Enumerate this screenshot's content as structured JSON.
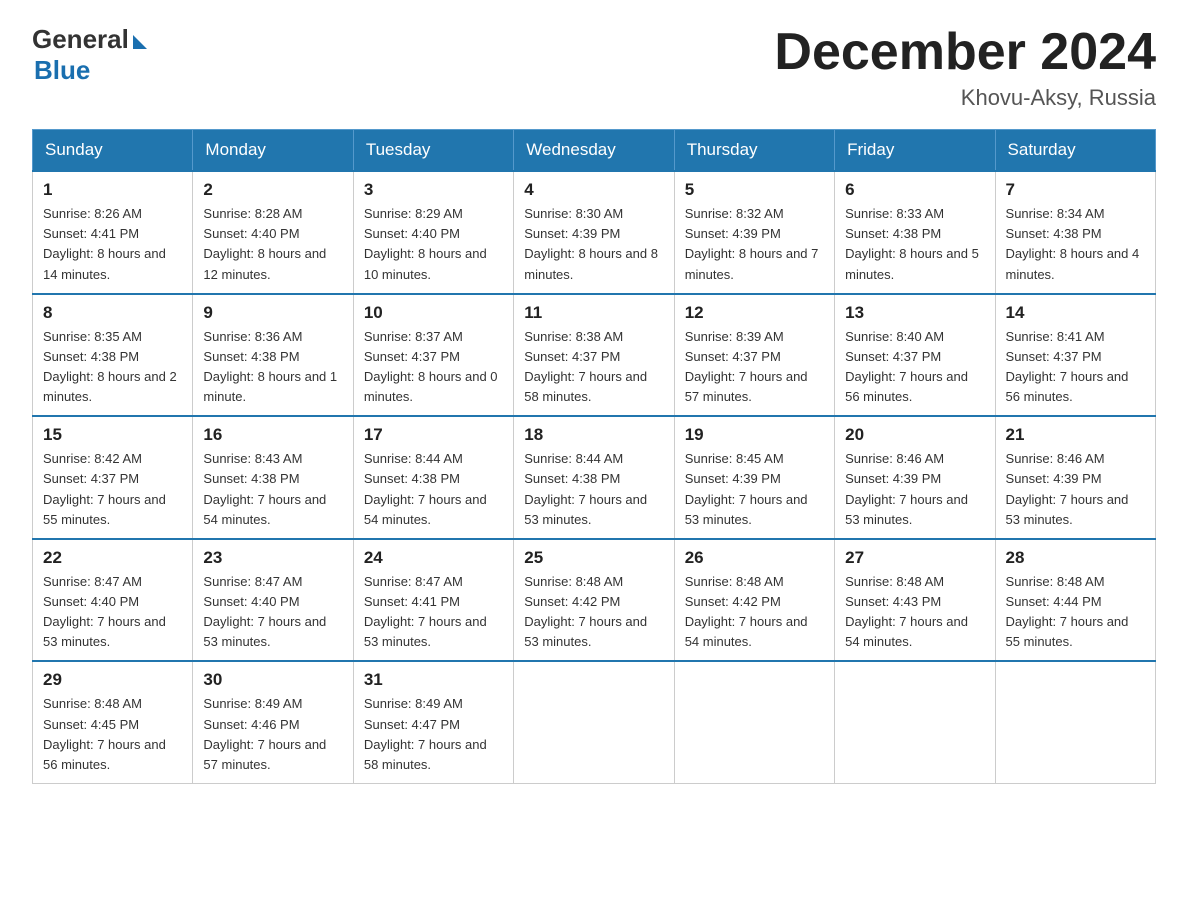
{
  "logo": {
    "general": "General",
    "blue": "Blue"
  },
  "title": "December 2024",
  "subtitle": "Khovu-Aksy, Russia",
  "days_of_week": [
    "Sunday",
    "Monday",
    "Tuesday",
    "Wednesday",
    "Thursday",
    "Friday",
    "Saturday"
  ],
  "weeks": [
    [
      {
        "day": "1",
        "sunrise": "8:26 AM",
        "sunset": "4:41 PM",
        "daylight": "8 hours and 14 minutes."
      },
      {
        "day": "2",
        "sunrise": "8:28 AM",
        "sunset": "4:40 PM",
        "daylight": "8 hours and 12 minutes."
      },
      {
        "day": "3",
        "sunrise": "8:29 AM",
        "sunset": "4:40 PM",
        "daylight": "8 hours and 10 minutes."
      },
      {
        "day": "4",
        "sunrise": "8:30 AM",
        "sunset": "4:39 PM",
        "daylight": "8 hours and 8 minutes."
      },
      {
        "day": "5",
        "sunrise": "8:32 AM",
        "sunset": "4:39 PM",
        "daylight": "8 hours and 7 minutes."
      },
      {
        "day": "6",
        "sunrise": "8:33 AM",
        "sunset": "4:38 PM",
        "daylight": "8 hours and 5 minutes."
      },
      {
        "day": "7",
        "sunrise": "8:34 AM",
        "sunset": "4:38 PM",
        "daylight": "8 hours and 4 minutes."
      }
    ],
    [
      {
        "day": "8",
        "sunrise": "8:35 AM",
        "sunset": "4:38 PM",
        "daylight": "8 hours and 2 minutes."
      },
      {
        "day": "9",
        "sunrise": "8:36 AM",
        "sunset": "4:38 PM",
        "daylight": "8 hours and 1 minute."
      },
      {
        "day": "10",
        "sunrise": "8:37 AM",
        "sunset": "4:37 PM",
        "daylight": "8 hours and 0 minutes."
      },
      {
        "day": "11",
        "sunrise": "8:38 AM",
        "sunset": "4:37 PM",
        "daylight": "7 hours and 58 minutes."
      },
      {
        "day": "12",
        "sunrise": "8:39 AM",
        "sunset": "4:37 PM",
        "daylight": "7 hours and 57 minutes."
      },
      {
        "day": "13",
        "sunrise": "8:40 AM",
        "sunset": "4:37 PM",
        "daylight": "7 hours and 56 minutes."
      },
      {
        "day": "14",
        "sunrise": "8:41 AM",
        "sunset": "4:37 PM",
        "daylight": "7 hours and 56 minutes."
      }
    ],
    [
      {
        "day": "15",
        "sunrise": "8:42 AM",
        "sunset": "4:37 PM",
        "daylight": "7 hours and 55 minutes."
      },
      {
        "day": "16",
        "sunrise": "8:43 AM",
        "sunset": "4:38 PM",
        "daylight": "7 hours and 54 minutes."
      },
      {
        "day": "17",
        "sunrise": "8:44 AM",
        "sunset": "4:38 PM",
        "daylight": "7 hours and 54 minutes."
      },
      {
        "day": "18",
        "sunrise": "8:44 AM",
        "sunset": "4:38 PM",
        "daylight": "7 hours and 53 minutes."
      },
      {
        "day": "19",
        "sunrise": "8:45 AM",
        "sunset": "4:39 PM",
        "daylight": "7 hours and 53 minutes."
      },
      {
        "day": "20",
        "sunrise": "8:46 AM",
        "sunset": "4:39 PM",
        "daylight": "7 hours and 53 minutes."
      },
      {
        "day": "21",
        "sunrise": "8:46 AM",
        "sunset": "4:39 PM",
        "daylight": "7 hours and 53 minutes."
      }
    ],
    [
      {
        "day": "22",
        "sunrise": "8:47 AM",
        "sunset": "4:40 PM",
        "daylight": "7 hours and 53 minutes."
      },
      {
        "day": "23",
        "sunrise": "8:47 AM",
        "sunset": "4:40 PM",
        "daylight": "7 hours and 53 minutes."
      },
      {
        "day": "24",
        "sunrise": "8:47 AM",
        "sunset": "4:41 PM",
        "daylight": "7 hours and 53 minutes."
      },
      {
        "day": "25",
        "sunrise": "8:48 AM",
        "sunset": "4:42 PM",
        "daylight": "7 hours and 53 minutes."
      },
      {
        "day": "26",
        "sunrise": "8:48 AM",
        "sunset": "4:42 PM",
        "daylight": "7 hours and 54 minutes."
      },
      {
        "day": "27",
        "sunrise": "8:48 AM",
        "sunset": "4:43 PM",
        "daylight": "7 hours and 54 minutes."
      },
      {
        "day": "28",
        "sunrise": "8:48 AM",
        "sunset": "4:44 PM",
        "daylight": "7 hours and 55 minutes."
      }
    ],
    [
      {
        "day": "29",
        "sunrise": "8:48 AM",
        "sunset": "4:45 PM",
        "daylight": "7 hours and 56 minutes."
      },
      {
        "day": "30",
        "sunrise": "8:49 AM",
        "sunset": "4:46 PM",
        "daylight": "7 hours and 57 minutes."
      },
      {
        "day": "31",
        "sunrise": "8:49 AM",
        "sunset": "4:47 PM",
        "daylight": "7 hours and 58 minutes."
      },
      null,
      null,
      null,
      null
    ]
  ]
}
